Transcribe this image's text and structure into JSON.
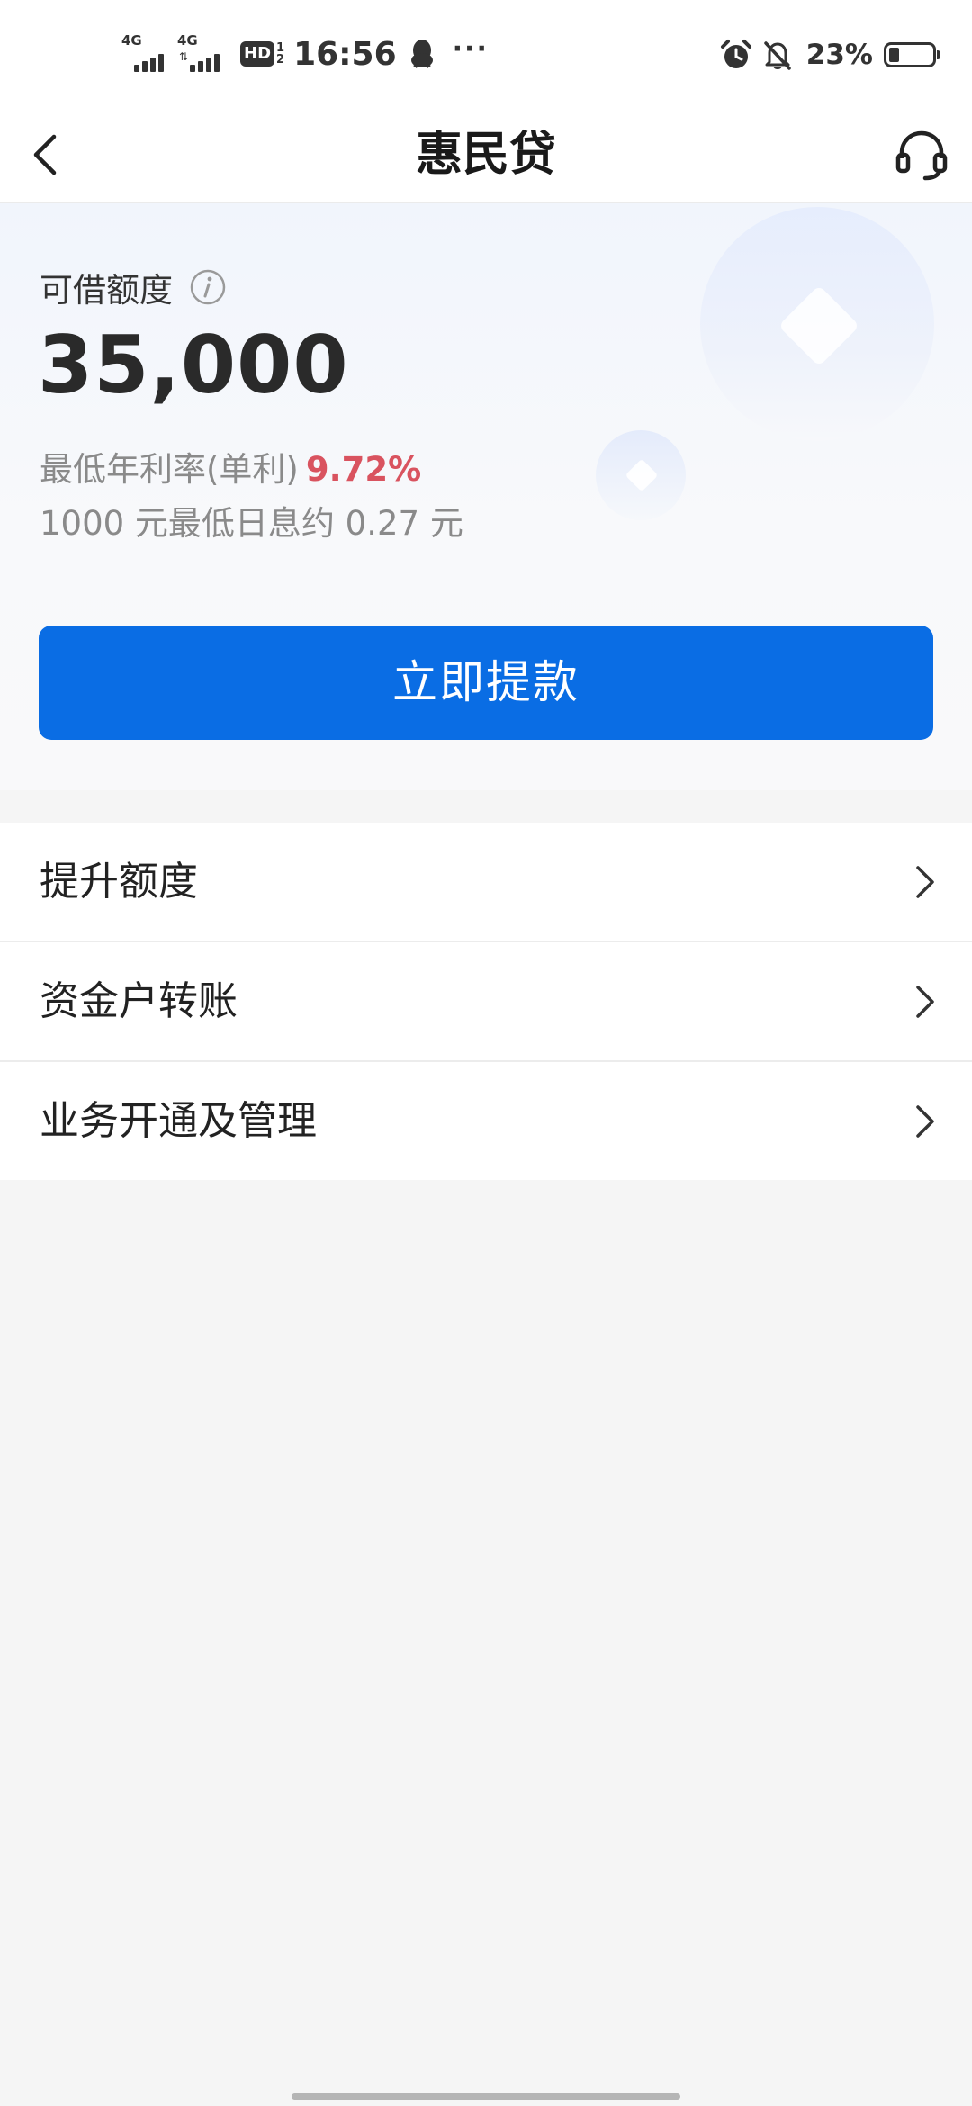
{
  "status_bar": {
    "sim1_tag": "4G",
    "sim2_tag": "4G",
    "hd_label": "HD",
    "hd_fraction_top": "1",
    "hd_fraction_bottom": "2",
    "time": "16:56",
    "more_dots": "···",
    "battery_percent": "23%",
    "battery_level": 0.23
  },
  "nav": {
    "title": "惠民贷",
    "icons": [
      "chevron-left-icon",
      "headset-icon"
    ]
  },
  "credit": {
    "limit_label": "可借额度",
    "limit_amount": "35,000",
    "rate_label": "最低年利率(单利)",
    "rate_value": "9.72%",
    "interest_text": "1000 元最低日息约 0.27 元",
    "withdraw_button": "立即提款",
    "colors": {
      "primary_button": "#0a6de4",
      "rate_highlight": "#d9535f"
    }
  },
  "menu": {
    "items": [
      {
        "label": "提升额度"
      },
      {
        "label": "资金户转账"
      },
      {
        "label": "业务开通及管理"
      }
    ]
  }
}
